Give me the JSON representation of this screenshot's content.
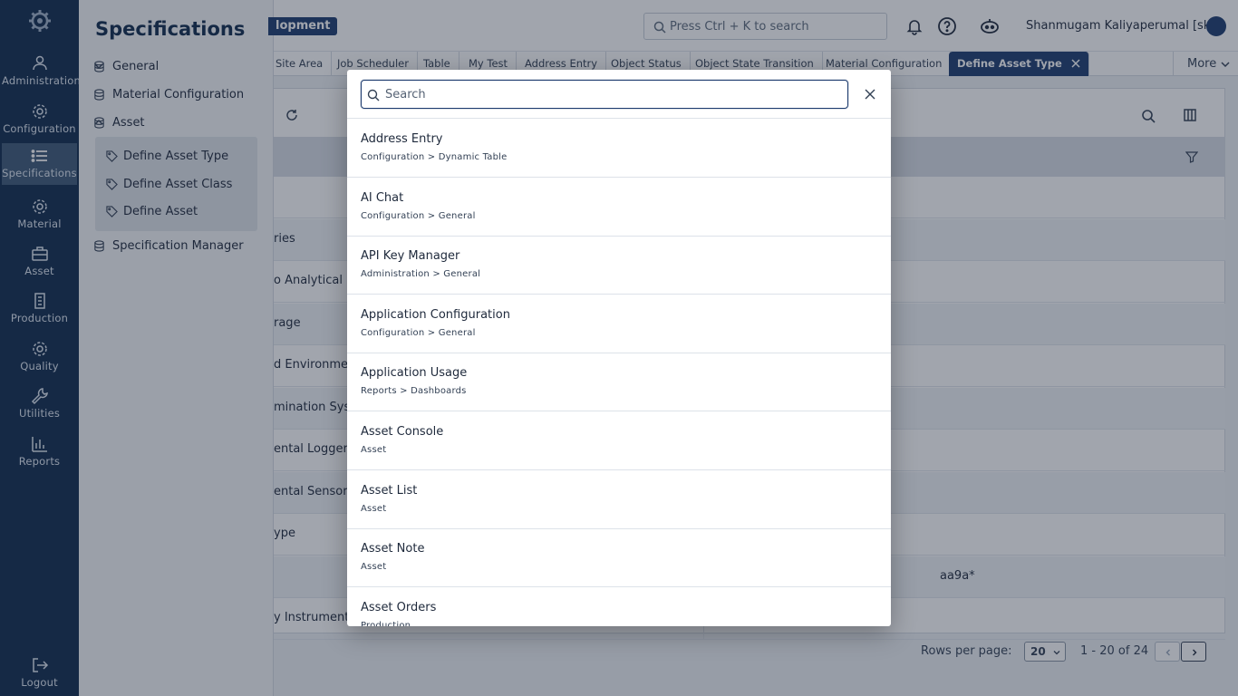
{
  "rail": {
    "items": [
      {
        "label": "Administration",
        "icon": "admin-icon"
      },
      {
        "label": "Configuration",
        "icon": "gear-icon"
      },
      {
        "label": "Specifications",
        "icon": "list-icon"
      },
      {
        "label": "Material",
        "icon": "gear-icon"
      },
      {
        "label": "Asset",
        "icon": "briefcase-icon"
      },
      {
        "label": "Production",
        "icon": "building-icon"
      },
      {
        "label": "Quality",
        "icon": "gear-icon"
      },
      {
        "label": "Utilities",
        "icon": "wrench-icon"
      },
      {
        "label": "Reports",
        "icon": "bar-chart-icon"
      }
    ],
    "logout": "Logout"
  },
  "subnav": {
    "title": "Specifications",
    "general": "General",
    "material_configuration": "Material Configuration",
    "asset": "Asset",
    "asset_children": [
      "Define Asset Type",
      "Define Asset Class",
      "Define Asset"
    ],
    "specification_manager": "Specification Manager"
  },
  "topbar": {
    "env_badge": "lopment",
    "search_placeholder": "Press Ctrl + K to search",
    "user_name": "Shanmugam Kaliyaperumal [sk]"
  },
  "tabs": {
    "items": [
      "Site Area",
      "Job Scheduler",
      "Table",
      "My Test",
      "Address Entry",
      "Object Status",
      "Object State Transition",
      "Material Configuration"
    ],
    "active": "Define Asset Type",
    "more": "More"
  },
  "table": {
    "rows": [
      {
        "c1": "",
        "c2": ""
      },
      {
        "c1": "ries",
        "c2": ""
      },
      {
        "c1": "o Analytical In",
        "c2": ""
      },
      {
        "c1": "rage",
        "c2": ""
      },
      {
        "c1": "d Environmen",
        "c2": ""
      },
      {
        "c1": "mination Syst",
        "c2": ""
      },
      {
        "c1": "ental Logger",
        "c2": ""
      },
      {
        "c1": "ental Sensor",
        "c2": ""
      },
      {
        "c1": "ype",
        "c2": ""
      },
      {
        "c1": "",
        "c2": "aa9a*"
      },
      {
        "c1": "y Instruments",
        "c2": ""
      }
    ]
  },
  "pager": {
    "rows_per_page_label": "Rows per page:",
    "rows_per_page": "20",
    "range": "1 - 20 of 24"
  },
  "modal": {
    "search_placeholder": "Search",
    "results": [
      {
        "title": "Address Entry",
        "path": "Configuration > Dynamic Table"
      },
      {
        "title": "AI Chat",
        "path": "Configuration > General"
      },
      {
        "title": "API Key Manager",
        "path": "Administration > General"
      },
      {
        "title": "Application Configuration",
        "path": "Configuration > General"
      },
      {
        "title": "Application Usage",
        "path": "Reports > Dashboards"
      },
      {
        "title": "Asset Console",
        "path": "Asset"
      },
      {
        "title": "Asset List",
        "path": "Asset"
      },
      {
        "title": "Asset Note",
        "path": "Asset"
      },
      {
        "title": "Asset Orders",
        "path": "Production"
      }
    ]
  },
  "colors": {
    "rail_bg": "#0f2a4d",
    "accent": "#1d3b6e"
  }
}
